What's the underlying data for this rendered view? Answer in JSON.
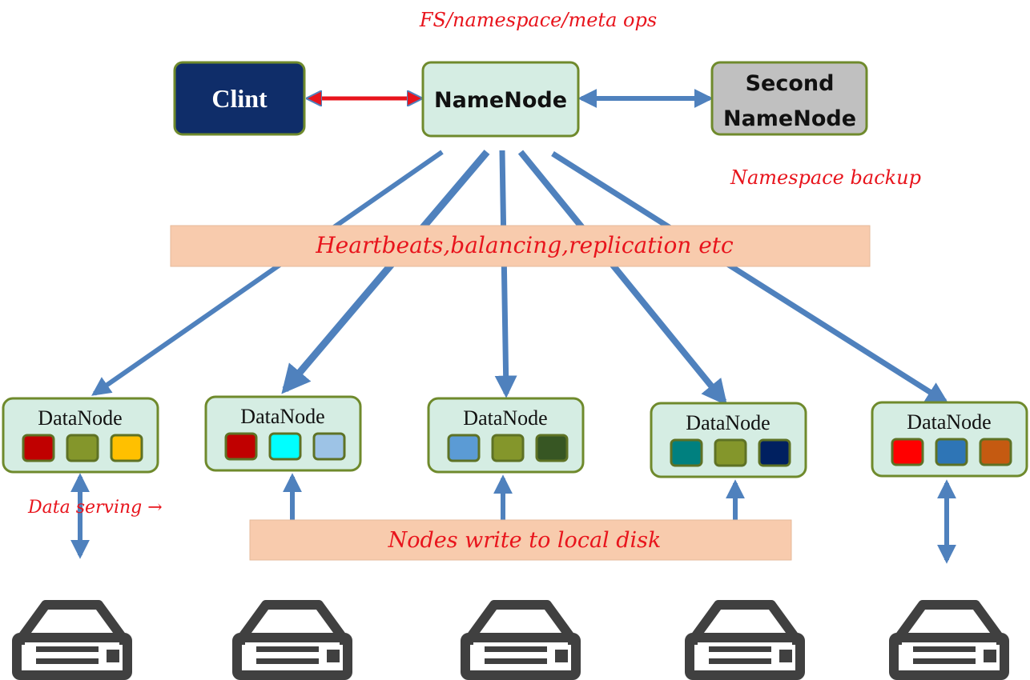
{
  "labels": {
    "top_note": "FS/namespace/meta ops",
    "backup_note": "Namespace backup",
    "heartbeat_banner": "Heartbeats,balancing,replication etc",
    "disk_banner": "Nodes write to local disk",
    "data_serving": "Data serving →"
  },
  "nodes": {
    "client": "Clint",
    "namenode": "NameNode",
    "secondary_line1": "Second",
    "secondary_line2": "NameNode"
  },
  "datanodes": [
    {
      "label": "DataNode",
      "blocks": [
        "#c00000",
        "#84962b",
        "#ffc000"
      ]
    },
    {
      "label": "DataNode",
      "blocks": [
        "#c00000",
        "#00ffff",
        "#9dc3e6"
      ]
    },
    {
      "label": "DataNode",
      "blocks": [
        "#5b9bd5",
        "#84962b",
        "#375623"
      ]
    },
    {
      "label": "DataNode",
      "blocks": [
        "#00807f",
        "#84962b",
        "#002060"
      ]
    },
    {
      "label": "DataNode",
      "blocks": [
        "#ff0000",
        "#2e75b6",
        "#c55a11"
      ]
    }
  ],
  "colors": {
    "client_fill": "#0f2d69",
    "node_fill": "#d5ede3",
    "node_border": "#6f8a2c",
    "secondary_fill": "#c0c0c0",
    "arrow": "#4f81bd",
    "banner": "#f8cbad",
    "disk": "#404040",
    "note": "#e8141c"
  }
}
